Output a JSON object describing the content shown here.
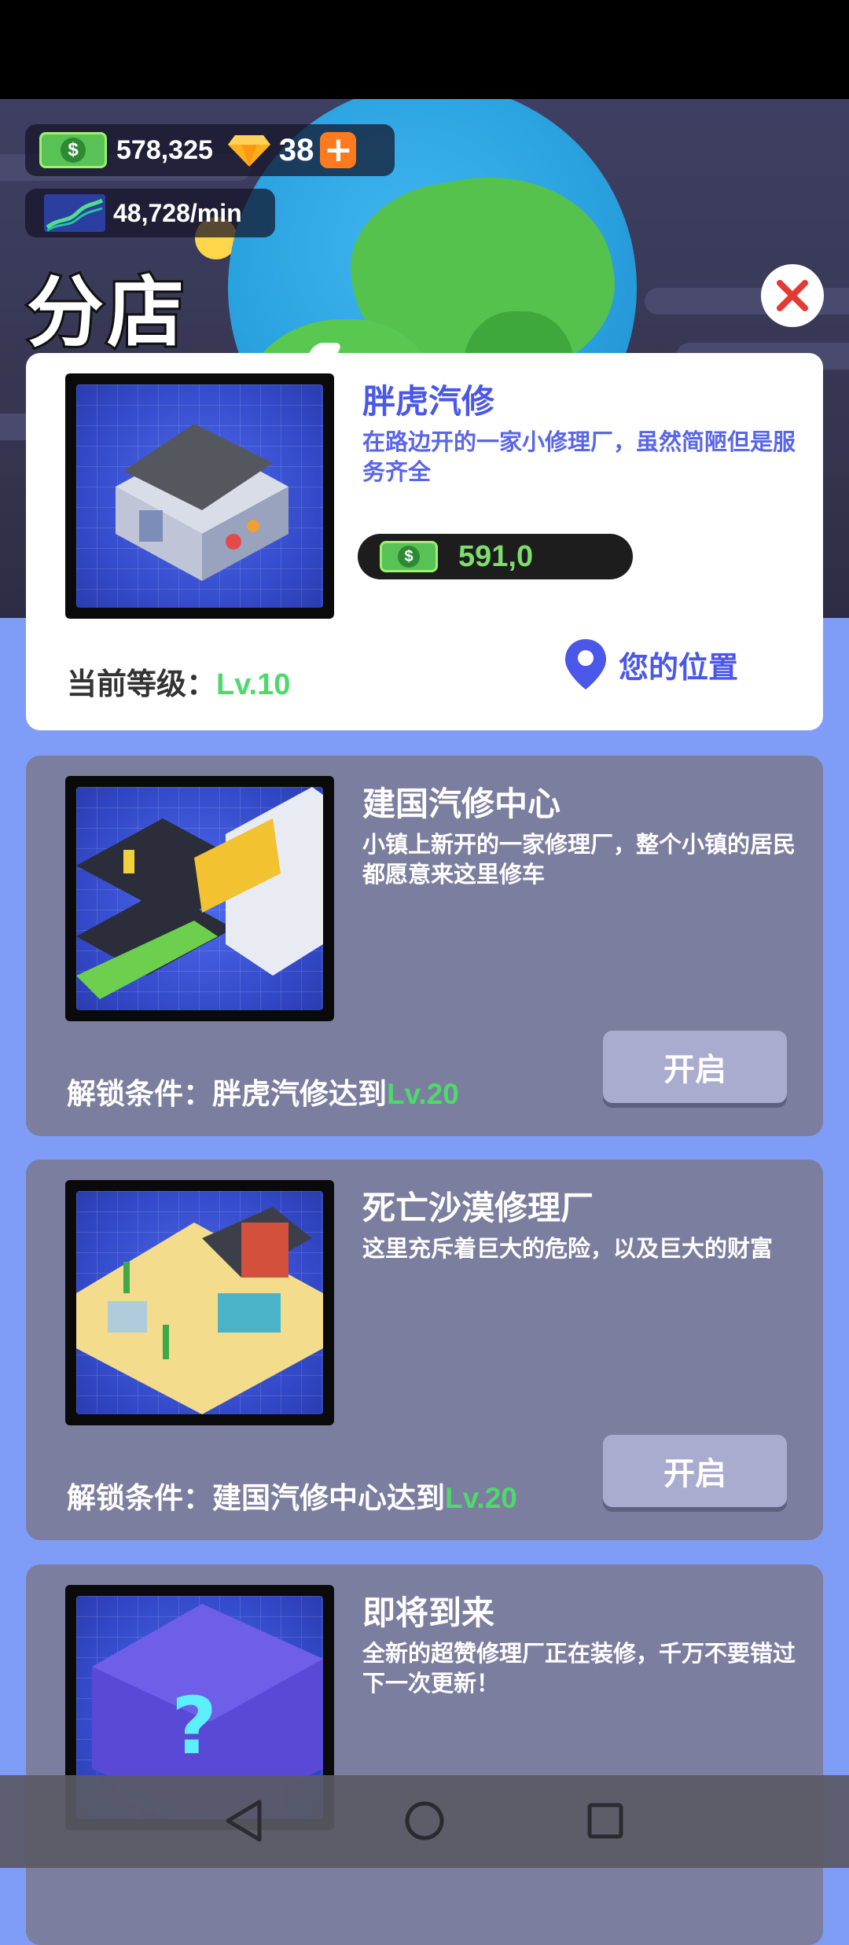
{
  "hud": {
    "cash": "578,325",
    "gems": "38",
    "plus": "+",
    "income_rate": "48,728/min"
  },
  "page_title": "分店",
  "shops": [
    {
      "name": "胖虎汽修",
      "description": "在路边开的一家小修理厂，虽然简陋但是服务齐全",
      "price": "591,0",
      "level_label": "当前等级：",
      "level_value": "Lv.10",
      "location_label": "您的位置"
    },
    {
      "name": "建国汽修中心",
      "description": "小镇上新开的一家修理厂，整个小镇的居民都愿意来这里修车",
      "unlock_label": "解锁条件：胖虎汽修达到",
      "unlock_level": "Lv.20",
      "button_label": "开启"
    },
    {
      "name": "死亡沙漠修理厂",
      "description": "这里充斥着巨大的危险，以及巨大的财富",
      "unlock_label": "解锁条件：建国汽修中心达到",
      "unlock_level": "Lv.20",
      "button_label": "开启"
    },
    {
      "name": "即将到来",
      "description": "全新的超赞修理厂正在装修，千万不要错过下一次更新！"
    }
  ],
  "icons": {
    "cash": "cash-icon",
    "gem": "gem-icon",
    "income": "income-chart-icon",
    "close": "close-icon",
    "location": "location-pin-icon",
    "back": "back-icon",
    "home": "home-icon",
    "recent": "recent-apps-icon"
  },
  "colors": {
    "accent": "#4a57e8",
    "level_green": "#4fd86c",
    "close_red": "#e53935",
    "background": "#7f9cf6"
  }
}
